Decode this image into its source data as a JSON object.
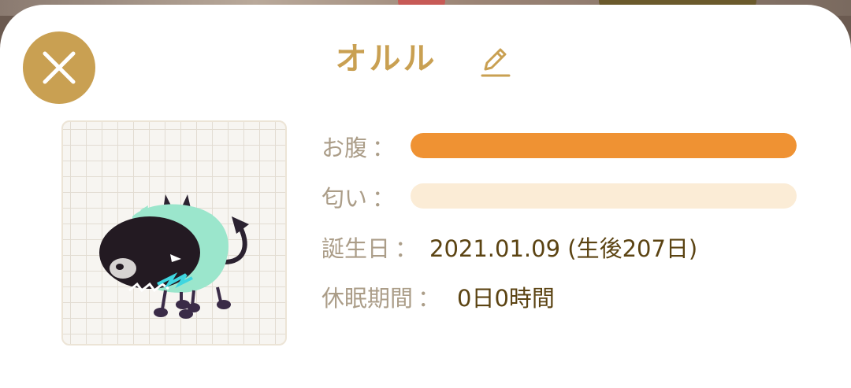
{
  "pet": {
    "name": "オルル"
  },
  "stats": {
    "hunger": {
      "label": "お腹",
      "level": 1.0,
      "color": "#ef9233"
    },
    "smell": {
      "label": "匂い",
      "level": 0.0,
      "color": "#fbecd6"
    },
    "birthday": {
      "label": "誕生日",
      "value": "2021.01.09 (生後207日)"
    },
    "hibernation": {
      "label": "休眠期間",
      "value": "0日0時間"
    }
  },
  "colon": "：",
  "icons": {
    "close": "close-icon",
    "edit": "pencil-icon"
  },
  "colors": {
    "accent": "#c9a052",
    "label": "#ab9d88",
    "value": "#5b4312"
  }
}
